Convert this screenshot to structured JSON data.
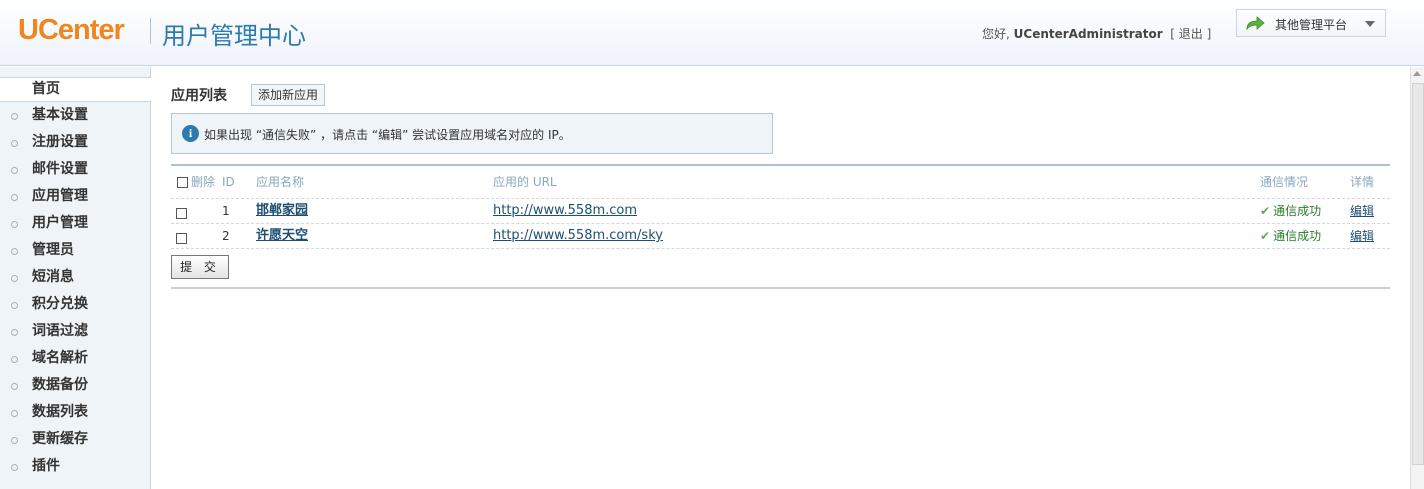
{
  "header": {
    "logo": "UCenter",
    "title": "用户管理中心",
    "greeting": "您好,",
    "username": "UCenterAdministrator",
    "logout_open": "[",
    "logout": "退出",
    "logout_close": "]",
    "platform_label": "其他管理平台"
  },
  "sidebar": {
    "items": [
      {
        "label": "首页"
      },
      {
        "label": "基本设置"
      },
      {
        "label": "注册设置"
      },
      {
        "label": "邮件设置"
      },
      {
        "label": "应用管理"
      },
      {
        "label": "用户管理"
      },
      {
        "label": "管理员"
      },
      {
        "label": "短消息"
      },
      {
        "label": "积分兑换"
      },
      {
        "label": "词语过滤"
      },
      {
        "label": "域名解析"
      },
      {
        "label": "数据备份"
      },
      {
        "label": "数据列表"
      },
      {
        "label": "更新缓存"
      },
      {
        "label": "插件"
      }
    ]
  },
  "main": {
    "heading": "应用列表",
    "add_button": "添加新应用",
    "notice": "如果出现 “通信失败” ，请点击 “编辑” 尝试设置应用域名对应的 IP。",
    "table": {
      "headers": {
        "delete": "删除",
        "id": "ID",
        "name": "应用名称",
        "url": "应用的 URL",
        "status": "通信情况",
        "detail": "详情"
      },
      "rows": [
        {
          "id": "1",
          "name": "邯郸家园",
          "url": "http://www.558m.com",
          "status": "通信成功",
          "detail": "编辑"
        },
        {
          "id": "2",
          "name": "许愿天空",
          "url": "http://www.558m.com/sky",
          "status": "通信成功",
          "detail": "编辑"
        }
      ]
    },
    "submit": "提 交"
  },
  "colors": {
    "logo": "#f0861f",
    "title": "#2b7bb0",
    "link": "#1d4f73",
    "success": "#58b24a"
  },
  "icons": {
    "platform": "share-arrow-icon",
    "notice": "info-icon",
    "status": "check-icon"
  }
}
